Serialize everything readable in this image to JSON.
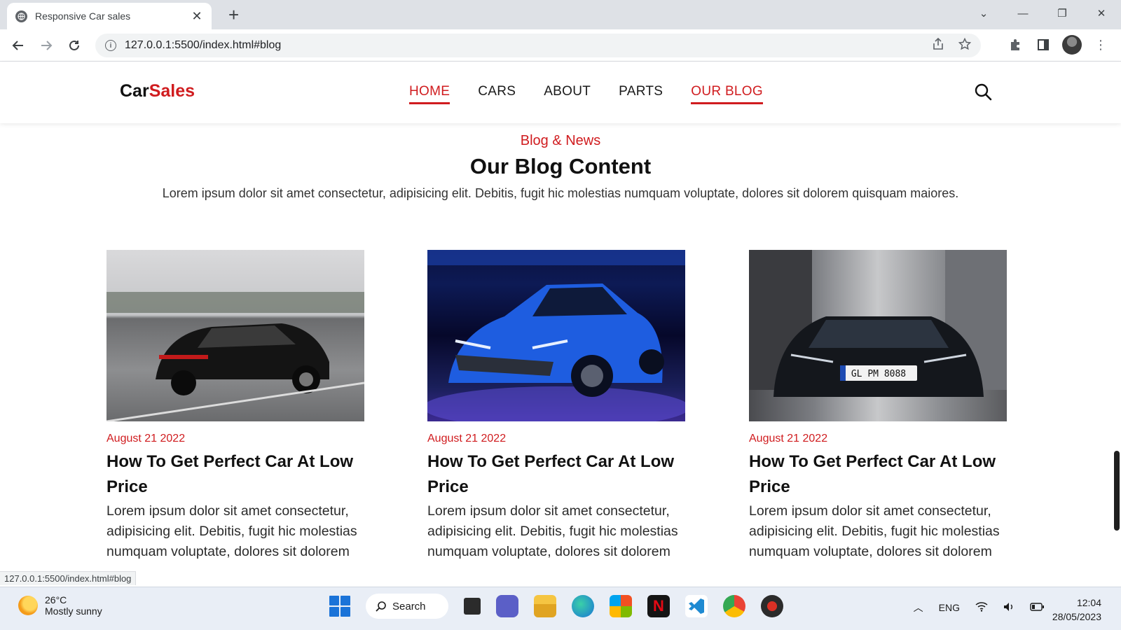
{
  "browser": {
    "tab_title": "Responsive Car sales",
    "url": "127.0.0.1:5500/index.html#blog",
    "status_url": "127.0.0.1:5500/index.html#blog"
  },
  "site": {
    "logo_part1": "Car",
    "logo_part2": "Sales",
    "nav": [
      "HOME",
      "CARS",
      "ABOUT",
      "PARTS",
      "OUR BLOG"
    ],
    "active_nav": "HOME"
  },
  "blog": {
    "eyebrow": "Blog & News",
    "heading": "Our Blog Content",
    "intro": "Lorem ipsum dolor sit amet consectetur, adipisicing elit. Debitis, fugit hic molestias numquam voluptate, dolores sit dolorem quisquam maiores.",
    "posts": [
      {
        "date": "August 21 2022",
        "title": "How To Get Perfect Car At Low Price",
        "body": "Lorem ipsum dolor sit amet consectetur, adipisicing elit. Debitis, fugit hic molestias numquam voluptate, dolores sit dolorem"
      },
      {
        "date": "August 21 2022",
        "title": "How To Get Perfect Car At Low Price",
        "body": "Lorem ipsum dolor sit amet consectetur, adipisicing elit. Debitis, fugit hic molestias numquam voluptate, dolores sit dolorem"
      },
      {
        "date": "August 21 2022",
        "title": "How To Get Perfect Car At Low Price",
        "body": "Lorem ipsum dolor sit amet consectetur, adipisicing elit. Debitis, fugit hic molestias numquam voluptate, dolores sit dolorem"
      }
    ],
    "plate_text": "GL PM 8088"
  },
  "taskbar": {
    "temperature": "26°C",
    "weather": "Mostly sunny",
    "search_label": "Search",
    "language": "ENG",
    "time": "12:04",
    "date": "28/05/2023"
  },
  "colors": {
    "accent": "#d01c1f",
    "text": "#111111"
  }
}
